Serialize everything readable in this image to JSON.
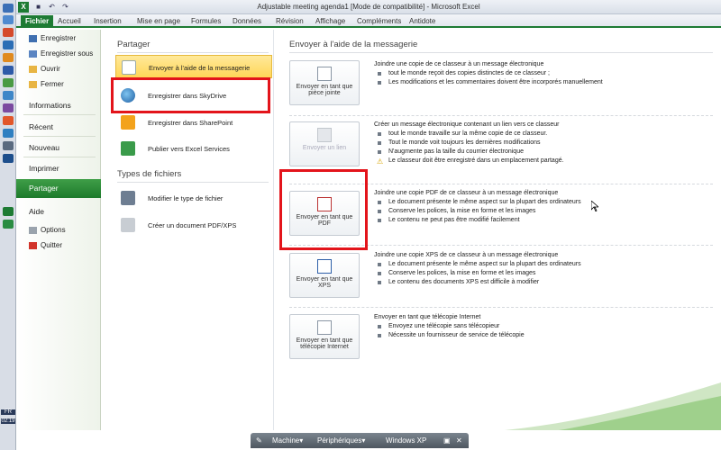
{
  "window": {
    "title": "Adjustable meeting agenda1  [Mode de compatibilité] - Microsoft Excel",
    "app_letter": "X",
    "qat_icons": [
      "save-icon",
      "undo-icon",
      "redo-icon"
    ]
  },
  "ribbon": {
    "tabs": [
      "Fichier",
      "Accueil",
      "Insertion",
      "Mise en page",
      "Formules",
      "Données",
      "Révision",
      "Affichage",
      "Compléments",
      "Antidote"
    ]
  },
  "nav": {
    "items": [
      {
        "label": "Enregistrer",
        "icon": "save-icon"
      },
      {
        "label": "Enregistrer sous",
        "icon": "save-as-icon"
      },
      {
        "label": "Ouvrir",
        "icon": "open-folder-icon"
      },
      {
        "label": "Fermer",
        "icon": "close-folder-icon"
      }
    ],
    "sections": [
      "Informations",
      "Récent",
      "Nouveau",
      "Imprimer"
    ],
    "active": "Partager",
    "help": "Aide",
    "help_items": [
      {
        "label": "Options",
        "icon": "options-icon"
      },
      {
        "label": "Quitter",
        "icon": "exit-icon"
      }
    ]
  },
  "share": {
    "title": "Partager",
    "options": [
      {
        "label": "Envoyer à l'aide de la messagerie",
        "icon": "email-icon"
      },
      {
        "label": "Enregistrer dans SkyDrive",
        "icon": "globe-icon"
      },
      {
        "label": "Enregistrer dans SharePoint",
        "icon": "sharepoint-icon"
      },
      {
        "label": "Publier vers Excel Services",
        "icon": "excel-services-icon"
      }
    ],
    "types_title": "Types de fichiers",
    "type_options": [
      {
        "label": "Modifier le type de fichier",
        "icon": "change-type-icon"
      },
      {
        "label": "Créer un document PDF/XPS",
        "icon": "pdf-xps-icon"
      }
    ]
  },
  "email": {
    "title": "Envoyer à l'aide de la messagerie",
    "actions": [
      {
        "button": "Envoyer en tant que pièce jointe",
        "icon": "attachment-icon",
        "heading": "Joindre une copie de ce classeur à un message électronique",
        "bullets": [
          "tout le monde reçoit des copies distinctes de ce classeur ;",
          "Les modifications et les commentaires doivent être incorporés manuellement"
        ]
      },
      {
        "button": "Envoyer un lien",
        "icon": "link-icon",
        "heading": "Créer un message électronique contenant un lien vers ce classeur",
        "bullets": [
          "tout le monde travaille sur la même copie de ce classeur.",
          "Tout le monde voit toujours les dernières modifications",
          "N'augmente pas la taille du courrier électronique"
        ],
        "warning": "Le classeur doit être enregistré dans un emplacement partagé."
      },
      {
        "button": "Envoyer en tant que PDF",
        "icon": "pdf-icon",
        "heading": "Joindre une copie PDF de ce classeur à un message électronique",
        "bullets": [
          "Le document présente le même aspect sur la plupart des ordinateurs",
          "Conserve les polices, la mise en forme et les images",
          "Le contenu ne peut pas être modifié facilement"
        ]
      },
      {
        "button": "Envoyer en tant que XPS",
        "icon": "xps-icon",
        "heading": "Joindre une copie XPS de ce classeur à un message électronique",
        "bullets": [
          "Le document présente le même aspect sur la plupart des ordinateurs",
          "Conserve les polices, la mise en forme et les images",
          "Le contenu des documents XPS est difficile à modifier"
        ]
      },
      {
        "button": "Envoyer en tant que télécopie Internet",
        "icon": "fax-icon",
        "heading": "Envoyer en tant que télécopie Internet",
        "bullets": [
          "Envoyez une télécopie sans télécopieur",
          "Nécessite un fournisseur de service de télécopie"
        ]
      }
    ]
  },
  "os": {
    "lang": "FR",
    "clock": "02:19"
  },
  "vmbar": {
    "machine": "Machine",
    "peripheriques": "Périphériques",
    "os_name": "Windows XP"
  },
  "colors": {
    "excel_green": "#1e7b34",
    "highlight": "#ffd657",
    "annotation_red": "#e3141b"
  }
}
